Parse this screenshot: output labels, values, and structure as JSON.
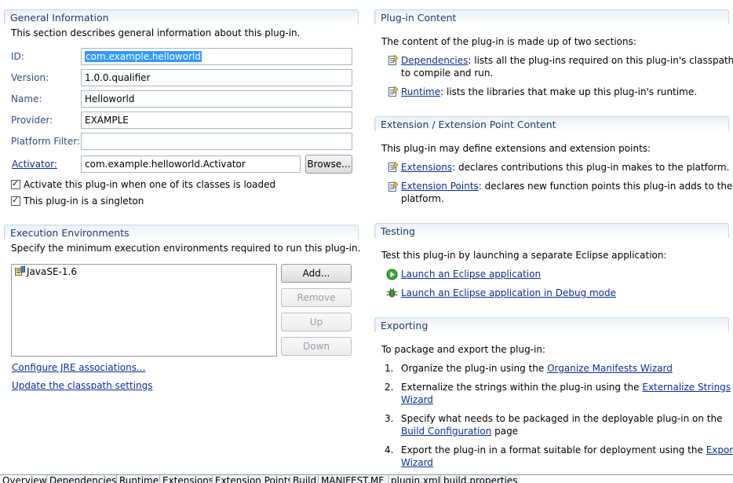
{
  "general": {
    "title": "General Information",
    "description": "This section describes general information about this plug-in.",
    "id_label": "ID:",
    "id_value": "com.example.helloworld",
    "version_label": "Version:",
    "version_value": "1.0.0.qualifier",
    "name_label": "Name:",
    "name_value": "Helloworld",
    "provider_label": "Provider:",
    "provider_value": "EXAMPLE",
    "platform_filter_label": "Platform Filter:",
    "platform_filter_value": "",
    "activator_label": "Activator:",
    "activator_value": "com.example.helloworld.Activator",
    "browse_label": "Browse...",
    "activate_check_label": "Activate this plug-in when one of its classes is loaded",
    "singleton_check_label": "This plug-in is a singleton"
  },
  "exec_env": {
    "title": "Execution Environments",
    "description": "Specify the minimum execution environments required to run this plug-in.",
    "items": [
      "JavaSE-1.6"
    ],
    "add_label": "Add...",
    "remove_label": "Remove",
    "up_label": "Up",
    "down_label": "Down",
    "configure_link": "Configure JRE associations...",
    "update_link": "Update the classpath settings"
  },
  "content": {
    "title": "Plug-in Content",
    "intro": "The content of the plug-in is made up of two sections:",
    "dependencies_link": "Dependencies",
    "dependencies_text_1": ": lists all the plug-ins required on this plug-in's classpath",
    "dependencies_text_2": "to compile and run.",
    "runtime_link": "Runtime",
    "runtime_text": ": lists the libraries that make up this plug-in's runtime."
  },
  "extension": {
    "title": "Extension / Extension Point Content",
    "intro": "This plug-in may define extensions and extension points:",
    "extensions_link": "Extensions",
    "extensions_text": ": declares contributions this plug-in makes to the platform.",
    "points_link": "Extension Points",
    "points_text_1": ": declares new function points this plug-in adds to the",
    "points_text_2": "platform."
  },
  "testing": {
    "title": "Testing",
    "intro": "Test this plug-in by launching a separate Eclipse application:",
    "launch_link": "Launch an Eclipse application",
    "debug_link": "Launch an Eclipse application in Debug mode"
  },
  "exporting": {
    "title": "Exporting",
    "intro": "To package and export the plug-in:",
    "step1_num": "1.",
    "step1_text": "Organize the plug-in using the ",
    "step1_link": "Organize Manifests Wizard",
    "step2_num": "2.",
    "step2_text": "Externalize the strings within the plug-in using the ",
    "step2_link_1": "Externalize Strings",
    "step2_link_2": "Wizard",
    "step3_num": "3.",
    "step3_text_1": "Specify what needs to be packaged in the deployable plug-in on the",
    "step3_link": "Build Configuration",
    "step3_text_2": " page",
    "step4_num": "4.",
    "step4_text": "Export the plug-in in a format suitable for deployment using the ",
    "step4_link_1": "Export",
    "step4_link_2": "Wizard"
  },
  "tabs": [
    "Overview",
    "Dependencies",
    "Runtime",
    "Extensions",
    "Extension Points",
    "Build",
    "MANIFEST.MF",
    "plugin.xml",
    "build.properties"
  ],
  "colors": {
    "section_title": "#1f3b68",
    "link": "#0b2e9a",
    "selection": "#3399ff",
    "label": "#2f4e7e"
  }
}
